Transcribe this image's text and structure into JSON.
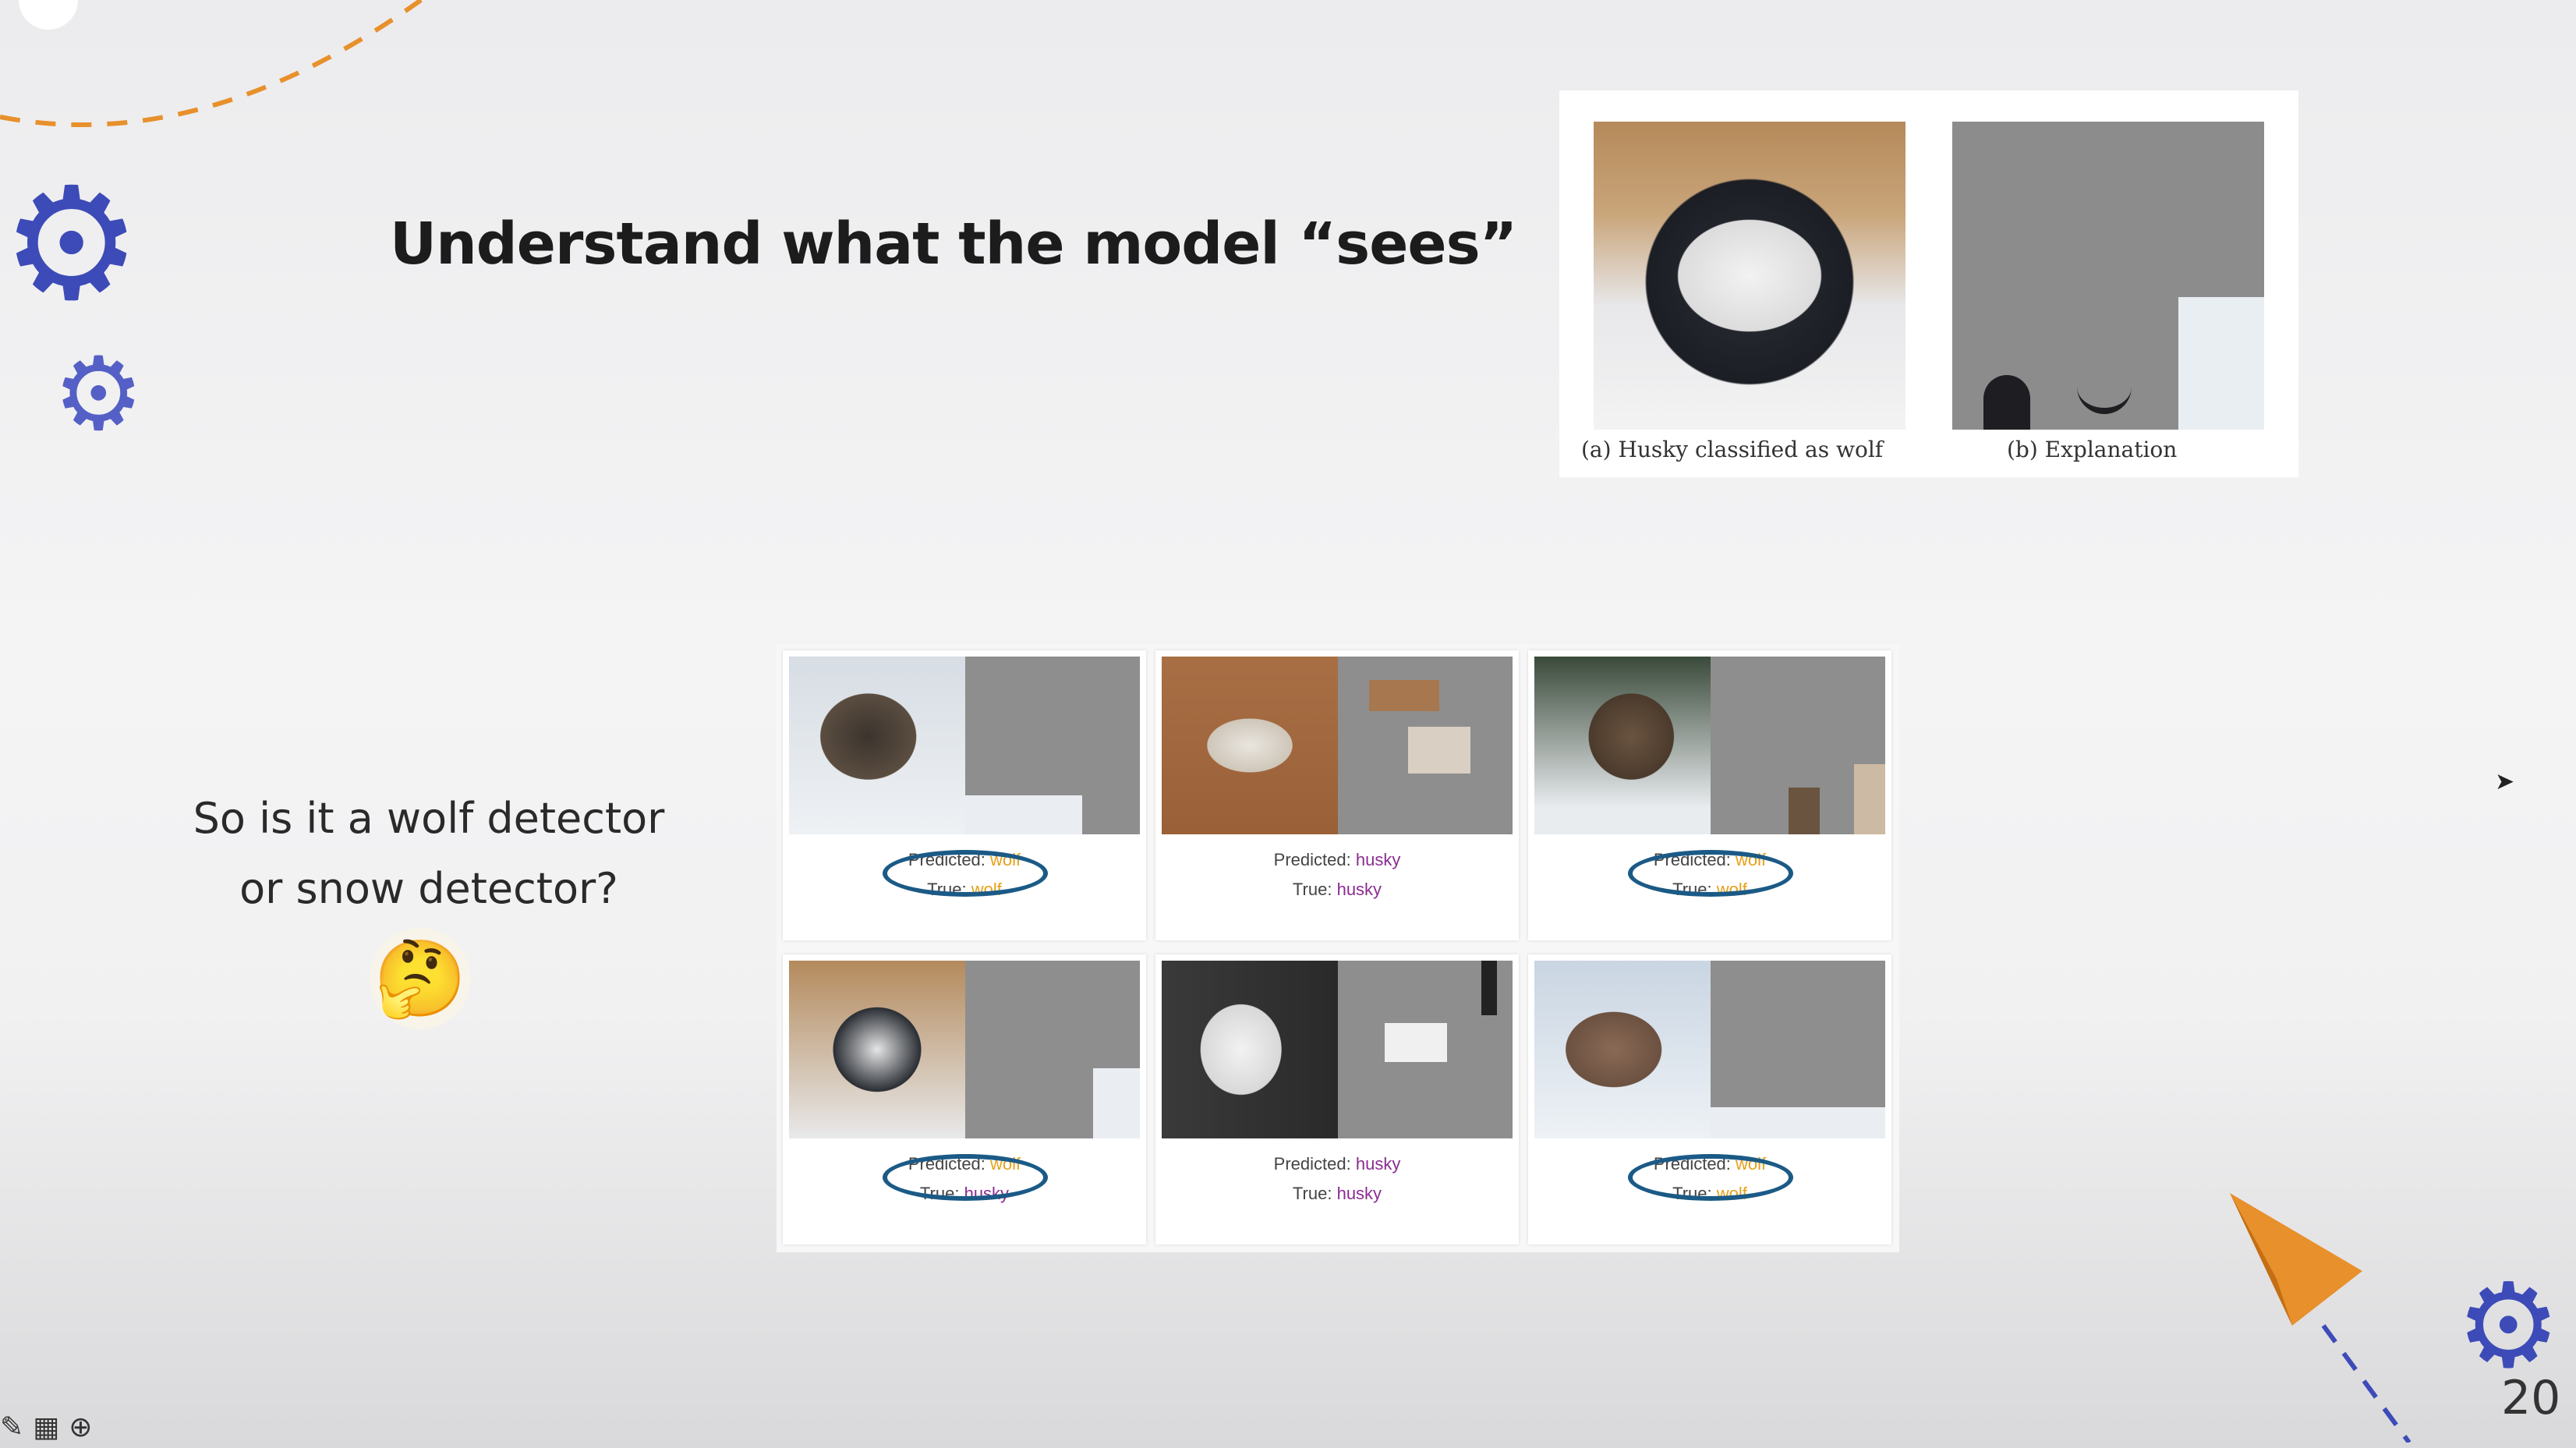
{
  "slide": {
    "title": "Understand what the model “sees”",
    "question_line1": "So is it a wolf detector",
    "question_line2": "or snow detector?",
    "emoji": "🤔",
    "page_number": "20"
  },
  "top_figure": {
    "caption_a": "(a) Husky classified as wolf",
    "caption_b": "(b) Explanation"
  },
  "grid": [
    {
      "predicted_label": "Predicted:",
      "predicted": "wolf",
      "true_label": "True:",
      "true": "wolf",
      "circled": true
    },
    {
      "predicted_label": "Predicted:",
      "predicted": "husky",
      "true_label": "True:",
      "true": "husky",
      "circled": false
    },
    {
      "predicted_label": "Predicted:",
      "predicted": "wolf",
      "true_label": "True:",
      "true": "wolf",
      "circled": true
    },
    {
      "predicted_label": "Predicted:",
      "predicted": "wolf",
      "true_label": "True:",
      "true": "husky",
      "circled": true
    },
    {
      "predicted_label": "Predicted:",
      "predicted": "husky",
      "true_label": "True:",
      "true": "husky",
      "circled": false
    },
    {
      "predicted_label": "Predicted:",
      "predicted": "wolf",
      "true_label": "True:",
      "true": "wolf",
      "circled": true
    }
  ],
  "colors": {
    "wolf": "#e6a11a",
    "husky": "#8a2c91",
    "circle": "#1b5a86",
    "gear": "#3d4bb8",
    "accent_orange": "#e8902c"
  },
  "icons": [
    "gear-icon",
    "thinking-face-icon",
    "paper-plane-icon",
    "pen-icon"
  ]
}
